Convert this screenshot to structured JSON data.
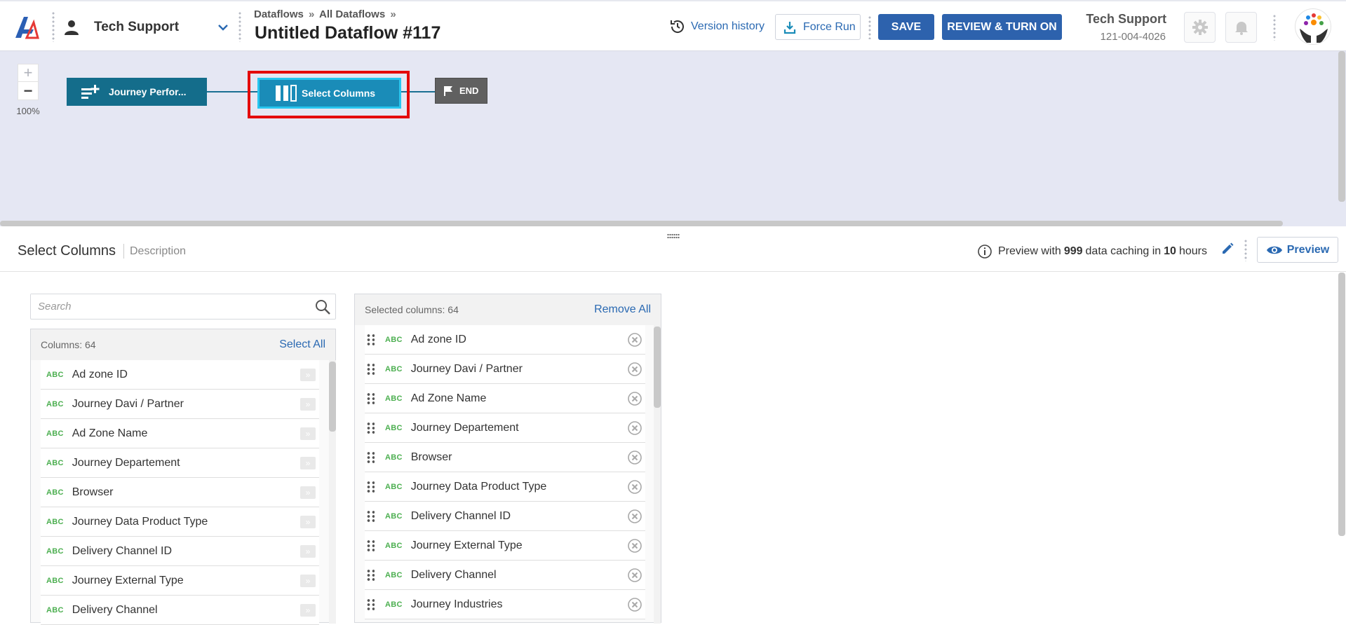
{
  "header": {
    "workspace": "Tech Support",
    "breadcrumbs": [
      "Dataflows",
      "All Dataflows"
    ],
    "breadcrumb_separator": "»",
    "title": "Untitled Dataflow #117",
    "version_history": "Version history",
    "force_run": "Force Run",
    "save": "SAVE",
    "review": "REVIEW & TURN ON",
    "user_name": "Tech Support",
    "user_phone": "121-004-4026"
  },
  "canvas": {
    "zoom_plus": "+",
    "zoom_minus": "−",
    "zoom_level": "100%",
    "nodes": [
      {
        "label": "Journey Perfor...",
        "icon": "add-list-icon",
        "color": "#146d8b"
      },
      {
        "label": "Select Columns",
        "icon": "columns-icon",
        "color": "#1a8cb8",
        "selected": true
      },
      {
        "label": "END",
        "icon": "flag-icon",
        "color": "#606060"
      }
    ],
    "highlight_color": "#e40a0a"
  },
  "panel": {
    "title": "Select Columns",
    "description": "Description",
    "preview_prefix": "Preview with",
    "preview_count": "999",
    "preview_mid": "data caching in",
    "preview_hours": "10",
    "preview_suffix": "hours",
    "preview_button": "Preview"
  },
  "search": {
    "placeholder": "Search"
  },
  "columns_list": {
    "header": "Columns: 64",
    "action": "Select All",
    "type_label": "ABC",
    "move_glyph": "»",
    "items": [
      "Ad zone ID",
      "Journey Davi / Partner",
      "Ad Zone Name",
      "Journey Departement",
      "Browser",
      "Journey Data Product Type",
      "Delivery Channel ID",
      "Journey External Type",
      "Delivery Channel"
    ]
  },
  "selected_list": {
    "header": "Selected columns: 64",
    "action": "Remove All",
    "type_label": "ABC",
    "items": [
      "Ad zone ID",
      "Journey Davi / Partner",
      "Ad Zone Name",
      "Journey Departement",
      "Browser",
      "Journey Data Product Type",
      "Delivery Channel ID",
      "Journey External Type",
      "Delivery Channel",
      "Journey Industries"
    ]
  },
  "colors": {
    "primary": "#2d62ad",
    "link": "#2a69b2",
    "canvas_bg": "#e5e7f3",
    "type_badge": "#4caf50"
  }
}
